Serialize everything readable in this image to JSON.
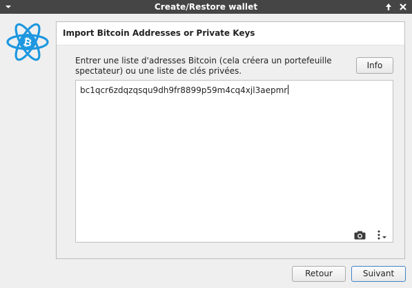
{
  "window": {
    "title": "Create/Restore wallet",
    "icons": {
      "menu": "chevron-down-icon",
      "keep_above": "arrow-up-icon",
      "close": "close-icon"
    }
  },
  "logo": {
    "name": "electrum-bitcoin-logo",
    "colors": {
      "orbit": "#1d97e0",
      "core": "#1d97e0"
    }
  },
  "header": {
    "title": "Import Bitcoin Addresses or Private Keys"
  },
  "main": {
    "description": "Entrer une liste d'adresses Bitcoin (cela créera un portefeuille spectateur) ou une liste de clés privées.",
    "info_label": "Info",
    "input_value": "bc1qcr6zdqzqsqu9dh9fr8899p59m4cq4xjl3aepmr",
    "input_icons": {
      "scan": "camera-icon",
      "options": "kebab-menu-icon"
    }
  },
  "footer": {
    "back_label": "Retour",
    "next_label": "Suivant"
  },
  "colors": {
    "titlebar": "#454545",
    "accent": "#3d82c8",
    "background": "#efefef"
  }
}
